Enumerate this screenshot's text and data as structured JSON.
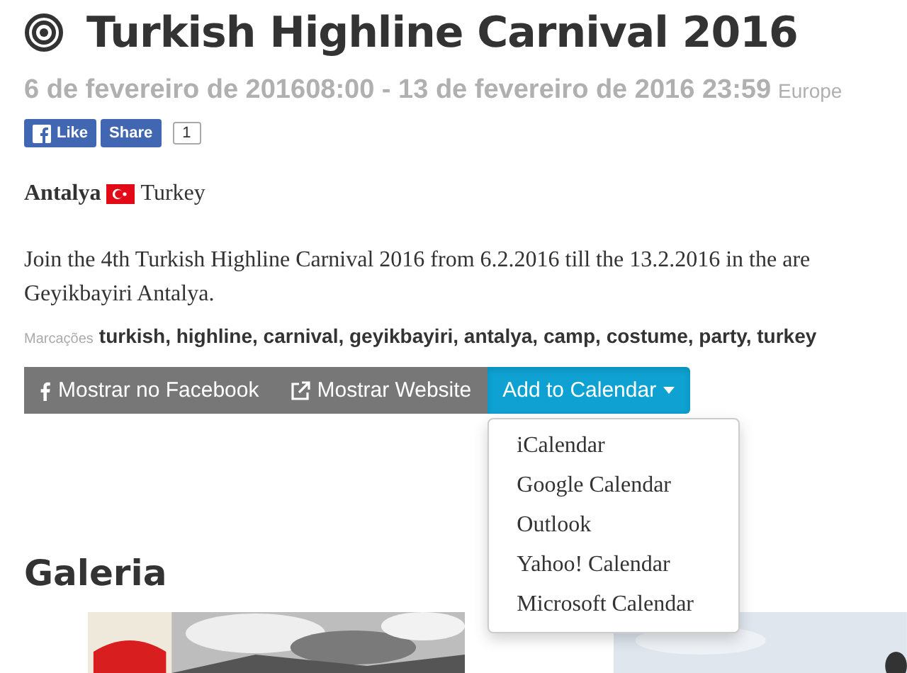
{
  "title": "Turkish Highline Carnival 2016",
  "date_line": {
    "range": "6 de fevereiro de 201608:00 - 13 de fevereiro de 2016 23:59",
    "timezone": "Europe"
  },
  "social": {
    "like": "Like",
    "share": "Share",
    "share_count": "1"
  },
  "location": {
    "city": "Antalya",
    "country": "Turkey"
  },
  "description_lines": [
    "Join the 4th Turkish Highline Carnival 2016 from 6.2.2016 till the 13.2.2016 in the are",
    "Geyikbayiri Antalya."
  ],
  "tags": {
    "label": "Marcações",
    "value": "turkish, highline, carnival, geyikbayiri, antalya, camp, costume, party, turkey"
  },
  "actions": [
    {
      "kind": "facebook",
      "label": "Mostrar no Facebook"
    },
    {
      "kind": "website",
      "label": "Mostrar Website"
    },
    {
      "kind": "calendar",
      "label": "Add to Calendar",
      "expanded": true
    }
  ],
  "calendar_menu": [
    "iCalendar",
    "Google Calendar",
    "Outlook",
    "Yahoo! Calendar",
    "Microsoft Calendar"
  ],
  "gallery": {
    "title": "Galeria"
  }
}
